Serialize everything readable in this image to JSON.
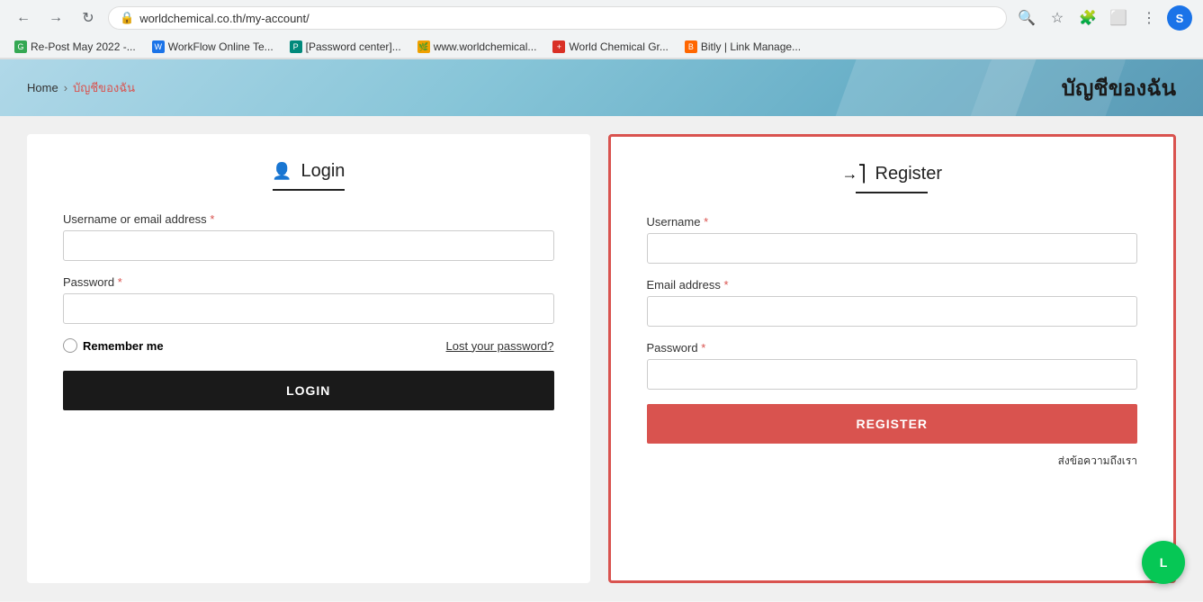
{
  "browser": {
    "url": "worldchemical.co.th/my-account/",
    "back_btn": "←",
    "forward_btn": "→",
    "refresh_btn": "↺",
    "profile_initial": "S",
    "bookmarks": [
      {
        "id": "bm1",
        "label": "Re-Post May 2022 -...",
        "color": "bm-green",
        "icon": "📄"
      },
      {
        "id": "bm2",
        "label": "WorkFlow Online Te...",
        "color": "bm-blue",
        "icon": "📄"
      },
      {
        "id": "bm3",
        "label": "[Password center]...",
        "color": "bm-teal",
        "icon": "📄"
      },
      {
        "id": "bm4",
        "label": "www.worldchemical...",
        "color": "bm-orange",
        "icon": "🌿"
      },
      {
        "id": "bm5",
        "label": "World Chemical Gr...",
        "color": "bm-red",
        "icon": "➕"
      },
      {
        "id": "bm6",
        "label": "Bitly | Link Manage...",
        "color": "bm-bitly",
        "icon": "🔗"
      }
    ]
  },
  "page_header": {
    "breadcrumb_home": "Home",
    "breadcrumb_current": "บัญชีของฉัน",
    "page_title": "บัญชีของฉัน"
  },
  "login_panel": {
    "title": "Login",
    "username_label": "Username or email address",
    "username_required": "*",
    "password_label": "Password",
    "password_required": "*",
    "remember_me_label": "Remember me",
    "lost_password_label": "Lost your password?",
    "login_btn_label": "LOGIN"
  },
  "register_panel": {
    "title": "Register",
    "username_label": "Username",
    "username_required": "*",
    "email_label": "Email address",
    "email_required": "*",
    "password_label": "Password",
    "password_required": "*",
    "register_btn_label": "REGISTER",
    "send_message_label": "ส่งข้อความถึงเรา"
  }
}
